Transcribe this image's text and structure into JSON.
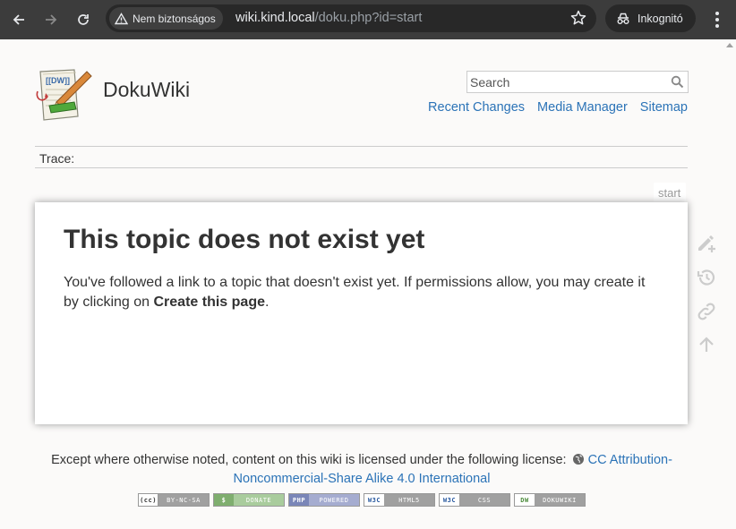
{
  "browser": {
    "security_label": "Nem biztonságos",
    "url_host": "wiki.kind.local",
    "url_path": "/doku.php?id=start",
    "incognito_label": "Inkognitó"
  },
  "header": {
    "site_title": "DokuWiki",
    "search_placeholder": "Search",
    "tools": [
      "Recent Changes",
      "Media Manager",
      "Sitemap"
    ]
  },
  "breadcrumbs": {
    "label": "Trace:"
  },
  "page": {
    "id": "start",
    "heading": "This topic does not exist yet",
    "text_before": "You've followed a link to a topic that doesn't exist yet. If permissions allow, you may create it by clicking on ",
    "create_link": "Create this page",
    "text_after": "."
  },
  "footer": {
    "license_text": "Except where otherwise noted, content on this wiki is licensed under the following license:",
    "license_link": "CC Attribution-Noncommercial-Share Alike 4.0 International",
    "badges": [
      {
        "left": "(cc)",
        "right": "BY-NC-SA",
        "color": "#a0a0a0"
      },
      {
        "left": "$",
        "right": "DONATE",
        "color": "#7fae6f"
      },
      {
        "left": "PHP",
        "right": "POWERED",
        "color": "#7a86b8"
      },
      {
        "left": "W3C",
        "right": "HTML5",
        "color": "#a0a0a0"
      },
      {
        "left": "W3C",
        "right": "CSS",
        "color": "#a0a0a0"
      },
      {
        "left": "DW",
        "right": "DOKUWIKI",
        "color": "#a0a0a0"
      }
    ]
  },
  "colors": {
    "link": "#2b73b7",
    "chrome": "#3c3c3c"
  }
}
